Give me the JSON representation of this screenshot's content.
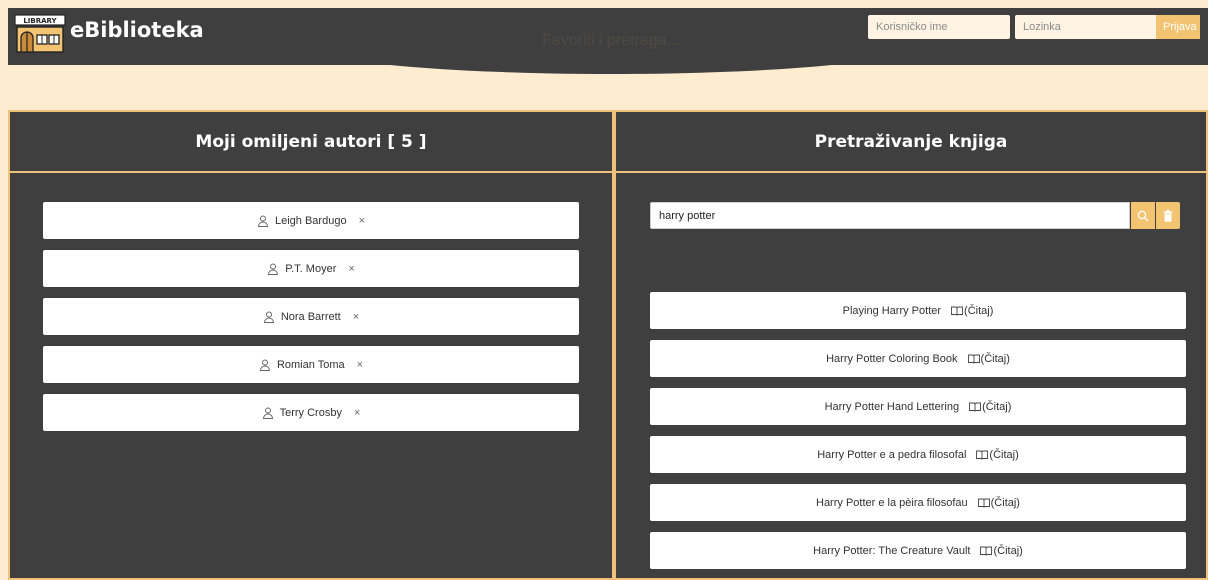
{
  "header": {
    "brand": "eBiblioteka",
    "logo_text": "LIBRARY",
    "center_text": "Favoriti i pretraga...",
    "username_placeholder": "Korisničko ime",
    "password_placeholder": "Lozinka",
    "login_label": "Prijava"
  },
  "favorites": {
    "title": "Moji omiljeni autori [ 5 ]",
    "authors": [
      {
        "name": "Leigh Bardugo"
      },
      {
        "name": "P.T. Moyer"
      },
      {
        "name": "Nora Barrett"
      },
      {
        "name": "Romian Toma"
      },
      {
        "name": "Terry Crosby"
      }
    ],
    "remove_symbol": "×"
  },
  "search": {
    "title": "Pretraživanje knjiga",
    "query": "harry potter",
    "read_label": "(Čitaj)",
    "results": [
      {
        "title": "Playing Harry Potter"
      },
      {
        "title": "Harry Potter Coloring Book"
      },
      {
        "title": "Harry Potter Hand Lettering"
      },
      {
        "title": "Harry Potter e a pedra filosofal"
      },
      {
        "title": "Harry Potter e la pèira filosofau"
      },
      {
        "title": "Harry Potter: The Creature Vault"
      }
    ]
  },
  "colors": {
    "background": "#fdecd0",
    "panel": "#3f3f3f",
    "accent": "#eec27a",
    "button": "#f2c371"
  },
  "icons": {
    "logo": "library-building-icon",
    "author": "person-icon",
    "remove": "close-icon",
    "search": "search-icon",
    "clear": "trash-icon",
    "read": "book-open-icon"
  }
}
